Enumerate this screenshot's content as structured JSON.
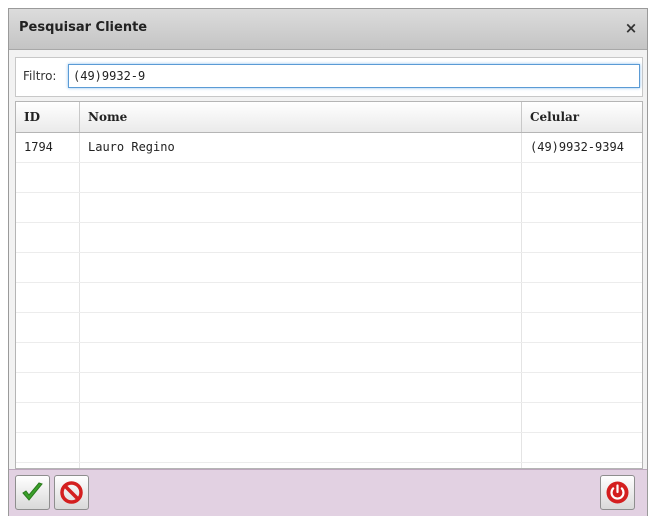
{
  "dialog": {
    "title": "Pesquisar Cliente",
    "close_label": "×"
  },
  "filter": {
    "label": "Filtro:",
    "value": "(49)9932-9"
  },
  "grid": {
    "columns": {
      "id": "ID",
      "nome": "Nome",
      "celular": "Celular"
    },
    "rows": [
      {
        "id": "1794",
        "nome": "Lauro Regino",
        "celular": "(49)9932-9394"
      }
    ]
  },
  "footer": {
    "confirm_icon": "checkmark-icon",
    "cancel_icon": "no-entry-icon",
    "exit_icon": "power-icon",
    "colors": {
      "footer_bg": "#e2d1e2",
      "check": "#3aa02a",
      "cancel": "#d41f1f",
      "power": "#d41f1f"
    }
  }
}
